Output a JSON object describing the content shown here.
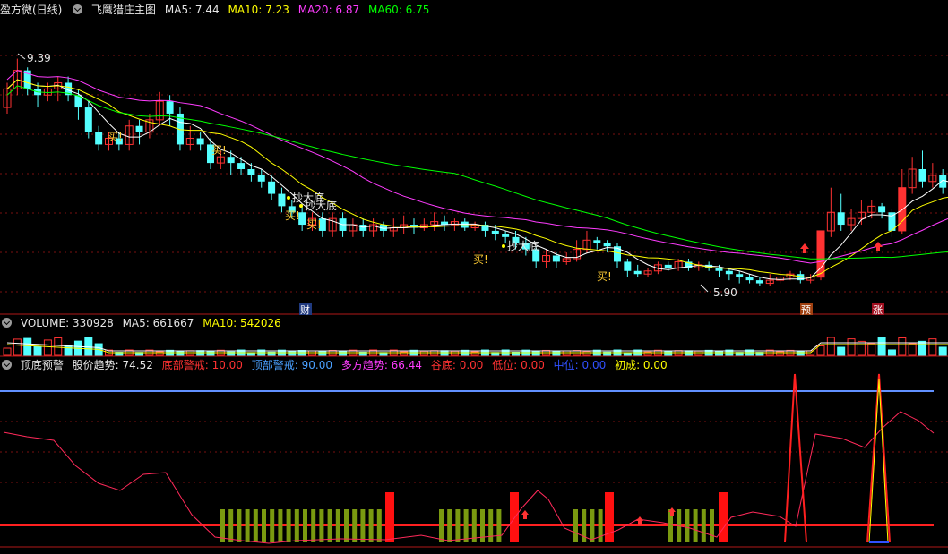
{
  "main_header": {
    "stock": "盈方微(日线)",
    "indicator": "飞鹰猎庄主图",
    "ma5": "MA5: 7.44",
    "ma10": "MA10: 7.23",
    "ma20": "MA20: 6.87",
    "ma60": "MA60: 6.75"
  },
  "price_labels": {
    "high": "9.39",
    "low": "5.90"
  },
  "signals": {
    "buy": [
      "买!",
      "买!",
      "买!",
      "买!",
      "买!",
      "买!"
    ],
    "bottom": [
      "抄大底",
      "抄大底",
      "抄大底"
    ]
  },
  "event_badges": {
    "cai": "财",
    "yu": "预",
    "zhang": "涨"
  },
  "volume_header": {
    "label": "VOLUME: 330928",
    "ma5": "MA5: 661667",
    "ma10": "MA10: 542026"
  },
  "indicator_header": {
    "name": "顶底预警",
    "trend": "股价趋势: 74.52",
    "bottom_warn": "底部警戒: 10.00",
    "top_warn": "顶部警戒: 90.00",
    "bull_trend": "多方趋势: 66.44",
    "valley": "谷底: 0.00",
    "low_pos": "低位: 0.00",
    "mid_pos": "中位: 0.00",
    "initial": "初成: 0.00"
  },
  "colors": {
    "up": "#ff3232",
    "down": "#54ffff",
    "ma5": "#ffffff",
    "ma10": "#ffff00",
    "ma20": "#ff3cff",
    "ma60": "#00ff00",
    "grid": "#7a1010"
  },
  "chart_data": {
    "type": "candlestick",
    "price_range": [
      5.9,
      9.39
    ],
    "candles": [
      [
        8.6,
        8.9,
        8.5,
        9.0
      ],
      [
        8.9,
        9.2,
        8.8,
        9.39
      ],
      [
        9.2,
        8.9,
        8.8,
        9.25
      ],
      [
        8.9,
        8.8,
        8.6,
        9.0
      ],
      [
        8.8,
        8.9,
        8.7,
        9.0
      ],
      [
        8.9,
        9.0,
        8.7,
        9.1
      ],
      [
        9.0,
        8.8,
        8.7,
        9.1
      ],
      [
        8.8,
        8.6,
        8.4,
        8.9
      ],
      [
        8.6,
        8.2,
        8.1,
        8.7
      ],
      [
        8.2,
        8.0,
        7.9,
        8.3
      ],
      [
        8.0,
        8.1,
        7.9,
        8.2
      ],
      [
        8.1,
        8.0,
        7.9,
        8.2
      ],
      [
        8.0,
        8.3,
        7.9,
        8.4
      ],
      [
        8.3,
        8.2,
        8.0,
        8.4
      ],
      [
        8.2,
        8.4,
        8.1,
        8.5
      ],
      [
        8.4,
        8.7,
        8.3,
        8.85
      ],
      [
        8.7,
        8.5,
        8.3,
        8.8
      ],
      [
        8.5,
        8.0,
        7.9,
        8.6
      ],
      [
        8.0,
        8.1,
        7.9,
        8.3
      ],
      [
        8.1,
        8.0,
        7.9,
        8.2
      ],
      [
        8.0,
        7.7,
        7.6,
        8.1
      ],
      [
        7.7,
        7.8,
        7.6,
        7.9
      ],
      [
        7.8,
        7.7,
        7.5,
        7.9
      ],
      [
        7.7,
        7.6,
        7.5,
        7.8
      ],
      [
        7.6,
        7.5,
        7.4,
        7.7
      ],
      [
        7.5,
        7.4,
        7.3,
        7.6
      ],
      [
        7.4,
        7.2,
        7.1,
        7.5
      ],
      [
        7.2,
        7.0,
        6.9,
        7.3
      ],
      [
        7.0,
        6.9,
        6.8,
        7.1
      ],
      [
        6.9,
        6.7,
        6.6,
        7.0
      ],
      [
        6.7,
        6.8,
        6.6,
        6.9
      ],
      [
        6.8,
        6.6,
        6.5,
        6.9
      ],
      [
        6.6,
        6.8,
        6.5,
        6.9
      ],
      [
        6.8,
        6.6,
        6.5,
        6.9
      ],
      [
        6.6,
        6.7,
        6.5,
        6.8
      ],
      [
        6.7,
        6.6,
        6.5,
        6.8
      ],
      [
        6.6,
        6.7,
        6.5,
        6.8
      ],
      [
        6.7,
        6.6,
        6.5,
        6.75
      ],
      [
        6.6,
        6.65,
        6.5,
        6.8
      ],
      [
        6.65,
        6.7,
        6.55,
        6.85
      ],
      [
        6.7,
        6.65,
        6.55,
        6.8
      ],
      [
        6.65,
        6.7,
        6.6,
        6.8
      ],
      [
        6.7,
        6.75,
        6.6,
        6.9
      ],
      [
        6.75,
        6.7,
        6.6,
        6.85
      ],
      [
        6.7,
        6.75,
        6.6,
        6.8
      ],
      [
        6.75,
        6.65,
        6.6,
        6.8
      ],
      [
        6.65,
        6.7,
        6.6,
        6.75
      ],
      [
        6.7,
        6.6,
        6.5,
        6.75
      ],
      [
        6.6,
        6.55,
        6.45,
        6.7
      ],
      [
        6.55,
        6.5,
        6.4,
        6.6
      ],
      [
        6.5,
        6.4,
        6.3,
        6.6
      ],
      [
        6.4,
        6.3,
        6.2,
        6.5
      ],
      [
        6.3,
        6.1,
        6.0,
        6.35
      ],
      [
        6.1,
        6.2,
        6.0,
        6.3
      ],
      [
        6.2,
        6.1,
        6.0,
        6.25
      ],
      [
        6.1,
        6.15,
        6.05,
        6.25
      ],
      [
        6.15,
        6.3,
        6.1,
        6.45
      ],
      [
        6.3,
        6.45,
        6.25,
        6.6
      ],
      [
        6.45,
        6.4,
        6.3,
        6.5
      ],
      [
        6.4,
        6.35,
        6.25,
        6.45
      ],
      [
        6.35,
        6.1,
        6.0,
        6.4
      ],
      [
        6.1,
        5.95,
        5.85,
        6.15
      ],
      [
        5.95,
        5.9,
        5.85,
        6.05
      ],
      [
        5.9,
        5.95,
        5.85,
        6.0
      ],
      [
        5.95,
        6.05,
        5.9,
        6.1
      ],
      [
        6.05,
        6.0,
        5.95,
        6.1
      ],
      [
        6.0,
        6.1,
        5.95,
        6.15
      ],
      [
        6.1,
        6.0,
        5.95,
        6.15
      ],
      [
        6.0,
        6.05,
        5.95,
        6.1
      ],
      [
        6.05,
        6.0,
        5.95,
        6.1
      ],
      [
        6.0,
        5.95,
        5.85,
        6.05
      ],
      [
        5.95,
        5.9,
        5.8,
        6.0
      ],
      [
        5.9,
        5.85,
        5.75,
        5.95
      ],
      [
        5.85,
        5.8,
        5.75,
        5.9
      ],
      [
        5.8,
        5.75,
        5.7,
        5.85
      ],
      [
        5.75,
        5.8,
        5.7,
        5.9
      ],
      [
        5.8,
        5.85,
        5.75,
        5.95
      ],
      [
        5.85,
        5.9,
        5.8,
        5.95
      ],
      [
        5.9,
        5.8,
        5.75,
        5.95
      ],
      [
        5.8,
        5.85,
        5.75,
        5.9
      ],
      [
        5.85,
        6.6,
        5.8,
        6.6
      ],
      [
        6.6,
        6.9,
        6.5,
        7.3
      ],
      [
        6.9,
        6.7,
        6.6,
        7.2
      ],
      [
        6.7,
        6.8,
        6.6,
        6.95
      ],
      [
        6.8,
        6.9,
        6.7,
        7.1
      ],
      [
        6.9,
        7.0,
        6.8,
        7.1
      ],
      [
        7.0,
        6.9,
        6.8,
        7.05
      ],
      [
        6.9,
        6.6,
        6.5,
        6.95
      ],
      [
        6.6,
        7.3,
        6.55,
        7.6
      ],
      [
        7.3,
        7.6,
        7.2,
        7.8
      ],
      [
        7.6,
        7.4,
        7.3,
        7.9
      ],
      [
        7.4,
        7.5,
        7.3,
        7.7
      ],
      [
        7.5,
        7.3,
        7.2,
        7.6
      ],
      [
        7.3,
        7.1,
        7.0,
        7.35
      ]
    ]
  }
}
